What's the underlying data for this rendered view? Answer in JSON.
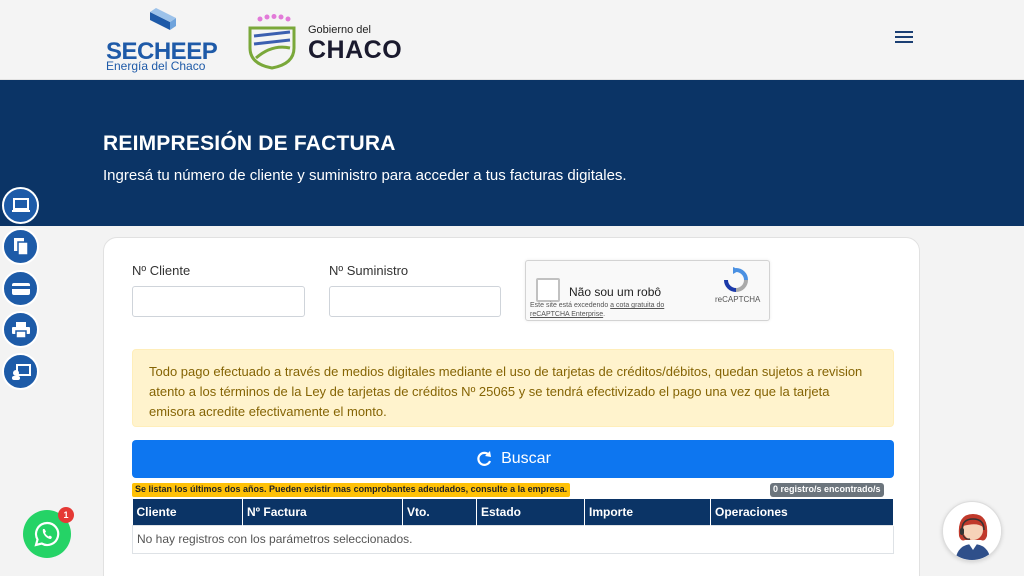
{
  "header": {
    "secheep_name": "SECHEEP",
    "secheep_sub": "Energía del Chaco",
    "gov_small": "Gobierno del",
    "gov_big": "CHACO"
  },
  "hero": {
    "title": "REIMPRESIÓN DE FACTURA",
    "subtitle": "Ingresá tu número de cliente y suministro para acceder a tus facturas digitales."
  },
  "form": {
    "cliente_label": "Nº Cliente",
    "cliente_value": "",
    "suministro_label": "Nº Suministro",
    "suministro_value": ""
  },
  "captcha": {
    "checkbox_label": "Não sou um robô",
    "note_prefix": "Este site está excedendo ",
    "note_link": "a cota gratuita do reCAPTCHA Enterprise",
    "note_suffix": ".",
    "brand": "reCAPTCHA"
  },
  "alert": {
    "text": "Todo pago efectuado a través de medios digitales mediante el uso de tarjetas de créditos/débitos, quedan sujetos a revision atento a los términos de la Ley de tarjetas de créditos Nº 25065 y se tendrá efectivizado el pago una vez que la tarjeta emisora acredite efectivamente el monto."
  },
  "search": {
    "button_label": "Buscar"
  },
  "results": {
    "note": "Se listan los últimos dos años. Pueden existir mas comprobantes adeudados, consulte a la empresa.",
    "count": "0 registro/s encontrado/s",
    "columns": [
      "Cliente",
      "Nº Factura",
      "Vto.",
      "Estado",
      "Importe",
      "Operaciones"
    ],
    "empty": "No hay registros con los parámetros seleccionados."
  },
  "whatsapp": {
    "badge": "1"
  },
  "colors": {
    "brand_blue": "#0b3466",
    "button_blue": "#0d76f0",
    "side_icon_blue": "#1d5ba8",
    "alert_bg": "#fff3cd",
    "whatsapp_green": "#25d366"
  },
  "side_icons": [
    "laptop-icon",
    "copy-document-icon",
    "credit-card-icon",
    "printer-icon",
    "support-screen-icon"
  ]
}
